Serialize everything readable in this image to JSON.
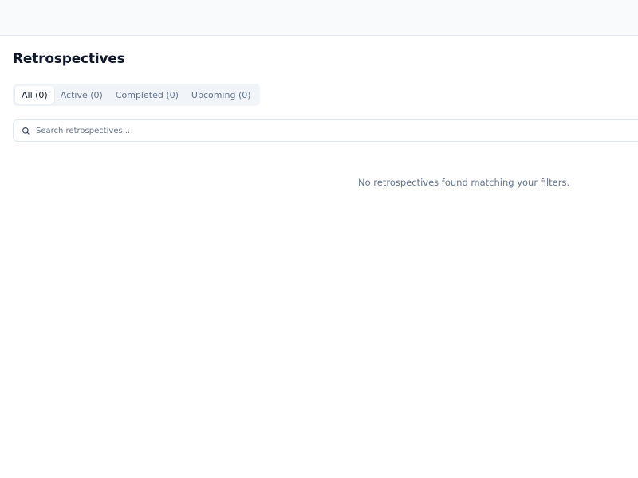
{
  "page": {
    "title": "Retrospectives"
  },
  "tabs": [
    {
      "label": "All (0)",
      "active": true
    },
    {
      "label": "Active (0)",
      "active": false
    },
    {
      "label": "Completed (0)",
      "active": false
    },
    {
      "label": "Upcoming (0)",
      "active": false
    }
  ],
  "search": {
    "placeholder": "Search retrospectives...",
    "value": "",
    "icon": "search-icon"
  },
  "empty_state": {
    "message": "No retrospectives found matching your filters."
  },
  "colors": {
    "title": "#0f172a",
    "muted_text": "#64748b",
    "tab_bar_bg": "#f1f5f9",
    "topbar_bg": "#f8fafc",
    "border": "#e2e8f0"
  }
}
